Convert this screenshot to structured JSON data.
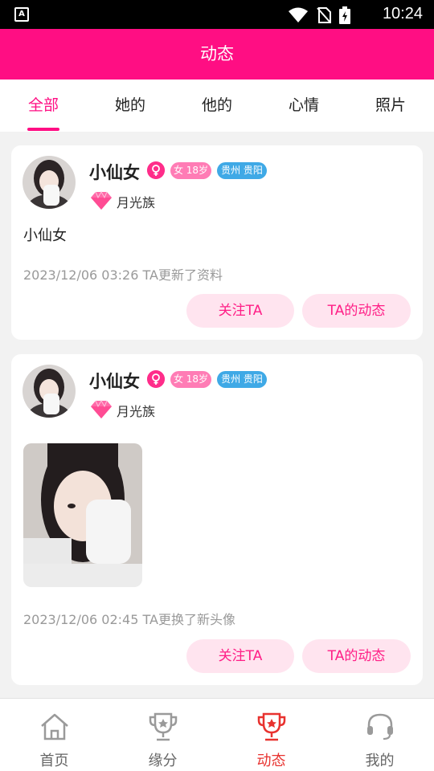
{
  "status_bar": {
    "time": "10:24",
    "left_icon": "A"
  },
  "header": {
    "title": "动态"
  },
  "tabs": [
    {
      "label": "全部",
      "active": true
    },
    {
      "label": "她的",
      "active": false
    },
    {
      "label": "他的",
      "active": false
    },
    {
      "label": "心情",
      "active": false
    },
    {
      "label": "照片",
      "active": false
    }
  ],
  "posts": [
    {
      "username": "小仙女",
      "age_badge": "女 18岁",
      "location_badge": "贵州 贵阳",
      "level": "月光族",
      "text": "小仙女",
      "timestamp": "2023/12/06 03:26 TA更新了资料",
      "follow_label": "关注TA",
      "feeds_label": "TA的动态"
    },
    {
      "username": "小仙女",
      "age_badge": "女 18岁",
      "location_badge": "贵州 贵阳",
      "level": "月光族",
      "timestamp": "2023/12/06 02:45 TA更换了新头像",
      "follow_label": "关注TA",
      "feeds_label": "TA的动态"
    }
  ],
  "bottom_nav": [
    {
      "label": "首页",
      "icon": "home-icon",
      "active": false
    },
    {
      "label": "缘分",
      "icon": "trophy-icon",
      "active": false
    },
    {
      "label": "动态",
      "icon": "trophy-icon",
      "active": true
    },
    {
      "label": "我的",
      "icon": "headset-icon",
      "active": false
    }
  ],
  "colors": {
    "brand": "#ff0e83",
    "active_nav": "#e8322f",
    "pill_bg": "#ffe4ef",
    "location_badge": "#3fa9e6",
    "age_badge": "#ff7cb5"
  }
}
